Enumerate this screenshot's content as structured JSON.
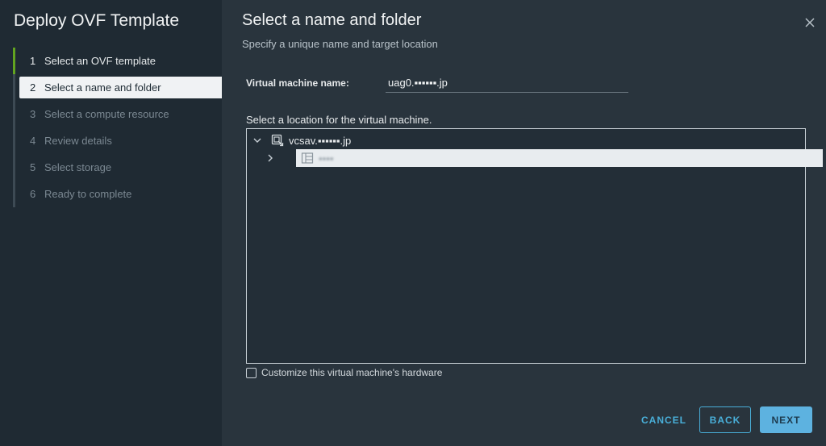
{
  "sidebar": {
    "title": "Deploy OVF Template",
    "steps": [
      {
        "num": "1",
        "label": "Select an OVF template"
      },
      {
        "num": "2",
        "label": "Select a name and folder"
      },
      {
        "num": "3",
        "label": "Select a compute resource"
      },
      {
        "num": "4",
        "label": "Review details"
      },
      {
        "num": "5",
        "label": "Select storage"
      },
      {
        "num": "6",
        "label": "Ready to complete"
      }
    ]
  },
  "main": {
    "title": "Select a name and folder",
    "subtitle": "Specify a unique name and target location",
    "vm_name_label": "Virtual machine name:",
    "vm_name_value": "uag0.▪▪▪▪▪▪.jp",
    "location_label": "Select a location for the virtual machine.",
    "tree": {
      "root_label": "vcsav.▪▪▪▪▪▪.jp",
      "child_label": "▪▪▪▪"
    },
    "customize_label": "Customize this virtual machine's hardware"
  },
  "footer": {
    "cancel_label": "CANCEL",
    "back_label": "BACK",
    "next_label": "NEXT"
  },
  "colors": {
    "accent": "#49afd9",
    "progress": "#62a420"
  }
}
